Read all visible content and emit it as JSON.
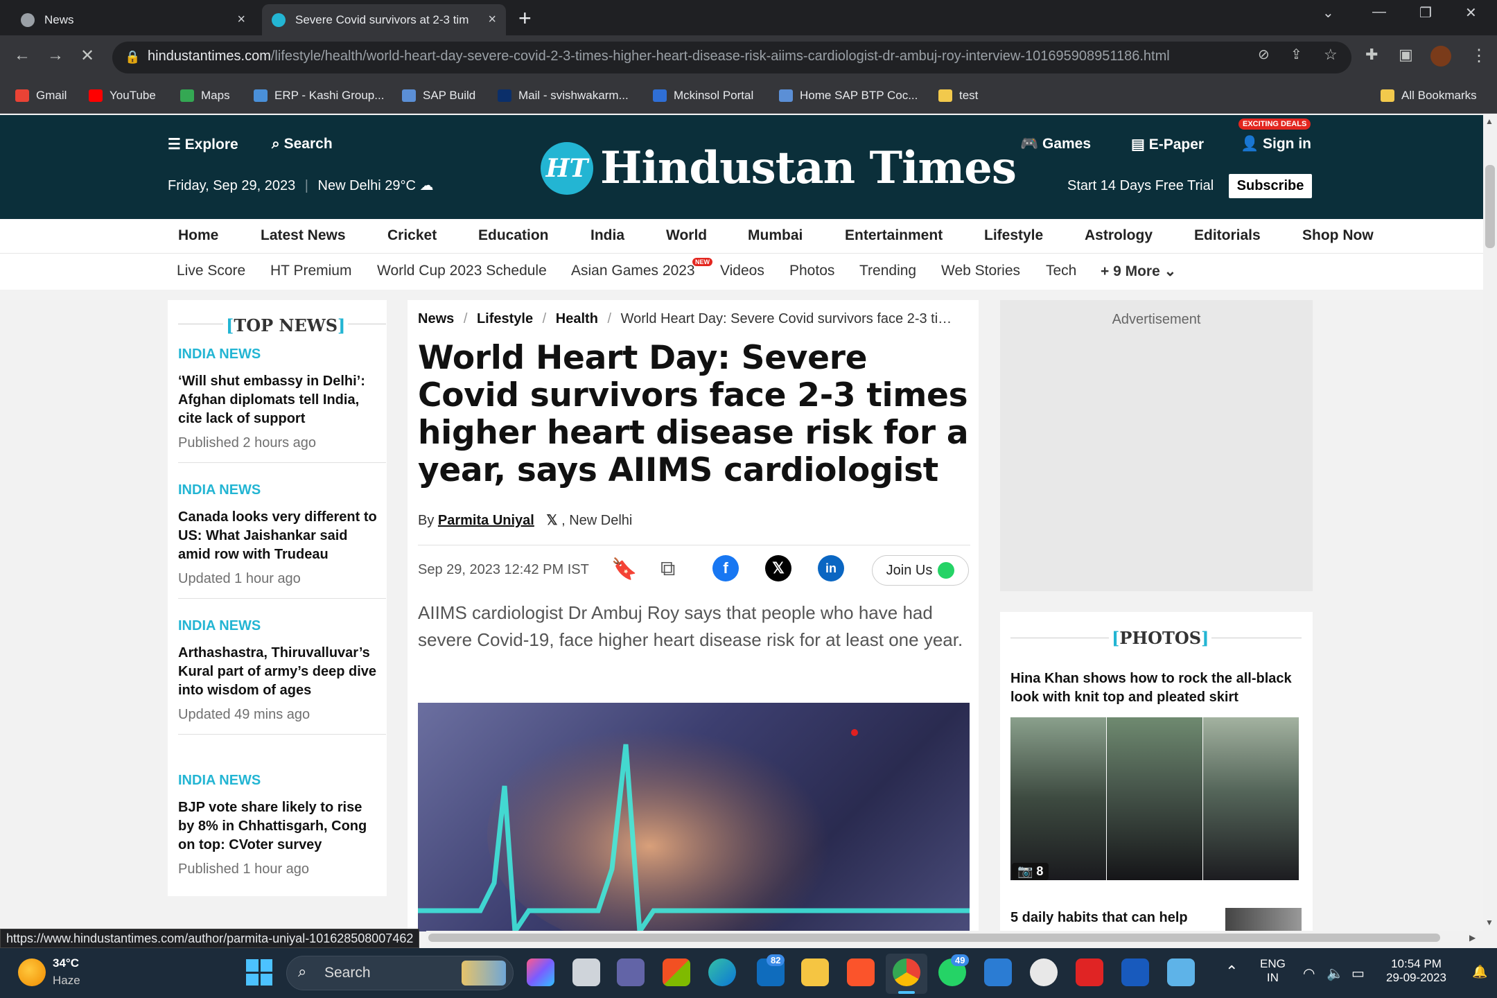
{
  "browser": {
    "tabs": [
      {
        "title": "News",
        "close": "×"
      },
      {
        "title": "Severe Covid survivors at 2-3 tim",
        "close": "×"
      }
    ],
    "new_tab": "+",
    "url_host": "hindustantimes.com",
    "url_path": "/lifestyle/health/world-heart-day-severe-covid-2-3-times-higher-heart-disease-risk-aiims-cardiologist-dr-ambuj-roy-interview-101695908951186.html",
    "bookmarks": [
      "Gmail",
      "YouTube",
      "Maps",
      "ERP - Kashi Group...",
      "SAP Build",
      "Mail - svishwakarm...",
      "Mckinsol Portal",
      "Home SAP BTP Coc...",
      "test"
    ],
    "all_bookmarks": "All Bookmarks",
    "status_url": "https://www.hindustantimes.com/author/parmita-uniyal-101628508007462"
  },
  "site": {
    "explore": "Explore",
    "search": "Search",
    "date": "Friday, Sep 29, 2023",
    "weather": "New Delhi 29°C",
    "logo_mark": "HT",
    "logo_text": "Hindustan Times",
    "games": "Games",
    "epaper": "E-Paper",
    "signin": "Sign in",
    "deals_badge": "EXCITING DEALS",
    "trial": "Start 14 Days Free Trial",
    "subscribe": "Subscribe"
  },
  "nav_primary": [
    "Home",
    "Latest News",
    "Cricket",
    "Education",
    "India",
    "World",
    "Mumbai",
    "Entertainment",
    "Lifestyle",
    "Astrology",
    "Editorials",
    "Shop Now"
  ],
  "nav_secondary": [
    "Live Score",
    "HT Premium",
    "World Cup 2023 Schedule",
    "Asian Games 2023",
    "Videos",
    "Photos",
    "Trending",
    "Web Stories",
    "Tech",
    "+ 9 More"
  ],
  "new_badge": "NEW",
  "top_news": {
    "title": "TOP NEWS",
    "items": [
      {
        "category": "INDIA NEWS",
        "headline": "‘Will shut embassy in Delhi’: Afghan diplomats tell India, cite lack of support",
        "time": "Published 2 hours ago"
      },
      {
        "category": "INDIA NEWS",
        "headline": "Canada looks very different to US: What Jaishankar said amid row with Trudeau",
        "time": "Updated 1 hour ago"
      },
      {
        "category": "INDIA NEWS",
        "headline": "Arthashastra, Thiruvalluvar’s Kural part of army’s deep dive into wisdom of ages",
        "time": "Updated 49 mins ago"
      },
      {
        "category": "INDIA NEWS",
        "headline": "BJP vote share likely to rise by 8% in Chhattisgarh, Cong on top: CVoter survey",
        "time": "Published 1 hour ago"
      }
    ]
  },
  "article": {
    "breadcrumb": [
      "News",
      "Lifestyle",
      "Health"
    ],
    "breadcrumb_current": "World Heart Day: Severe Covid survivors face 2-3 ti…",
    "headline": "World Heart Day: Severe Covid survivors face 2-3 times higher heart disease risk for a year, says AIIMS cardiologist",
    "by": "By",
    "author": "Parmita Uniyal",
    "location": ", New Delhi",
    "date": "Sep 29, 2023 12:42 PM IST",
    "join": "Join Us",
    "summary": "AIIMS cardiologist Dr Ambuj Roy says that people who have had severe Covid-19, face higher heart disease risk for at least one year."
  },
  "sidebar": {
    "ad_label": "Advertisement",
    "photos_title": "PHOTOS",
    "photo_story": "Hina Khan shows how to rock the all-black look with knit top and pleated skirt",
    "photo_count": "8",
    "next_story": "5 daily habits that can help"
  },
  "taskbar": {
    "temp": "34°C",
    "weather": "Haze",
    "search": "Search",
    "badge_outlook": "82",
    "badge_whatsapp": "49",
    "lang": "ENG",
    "region": "IN",
    "time": "10:54 PM",
    "date": "29-09-2023"
  },
  "colors": {
    "header_bg": "#0b2f3a",
    "accent": "#23b5d3",
    "chrome": "#35363a",
    "taskbar": "#1c2b3a"
  }
}
